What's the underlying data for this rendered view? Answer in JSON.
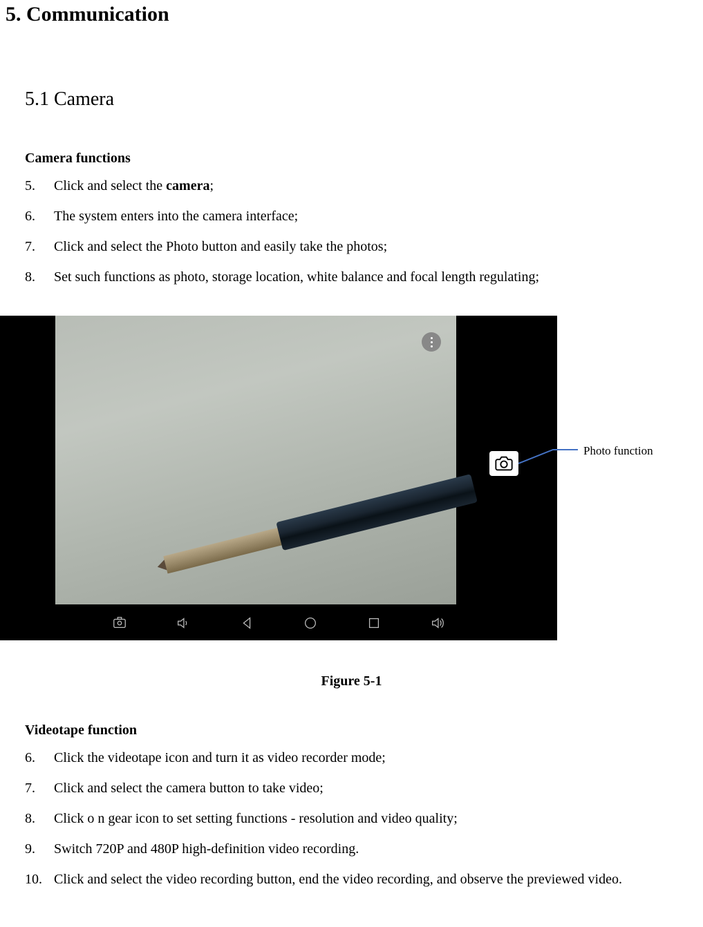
{
  "heading1": "5. Communication",
  "heading2": "5.1 Camera",
  "section1": {
    "title": "Camera functions",
    "items": [
      {
        "num": "5.",
        "text_pre": "Click and select the ",
        "bold": "camera",
        "text_post": ";"
      },
      {
        "num": "6.",
        "text": "The system enters into the camera interface;"
      },
      {
        "num": "7.",
        "text": "Click and select the Photo button and easily take the photos;"
      },
      {
        "num": "8.",
        "text": "Set such functions as photo, storage location, white balance and focal length regulating;"
      }
    ]
  },
  "figure": {
    "callout": "Photo function",
    "caption": "Figure 5-1"
  },
  "section2": {
    "title": "Videotape function",
    "items": [
      {
        "num": "6.",
        "text": "Click the videotape icon and turn it as video recorder mode;"
      },
      {
        "num": "7.",
        "text": "Click and select the camera button to take video;"
      },
      {
        "num": "8.",
        "text": "Click o n gear icon to set setting functions - resolution and video quality;"
      },
      {
        "num": "9.",
        "text": "Switch 720P and 480P high-definition video recording."
      },
      {
        "num": "10.",
        "text": "Click and select the video recording button, end the video recording, and observe the previewed video."
      }
    ]
  }
}
